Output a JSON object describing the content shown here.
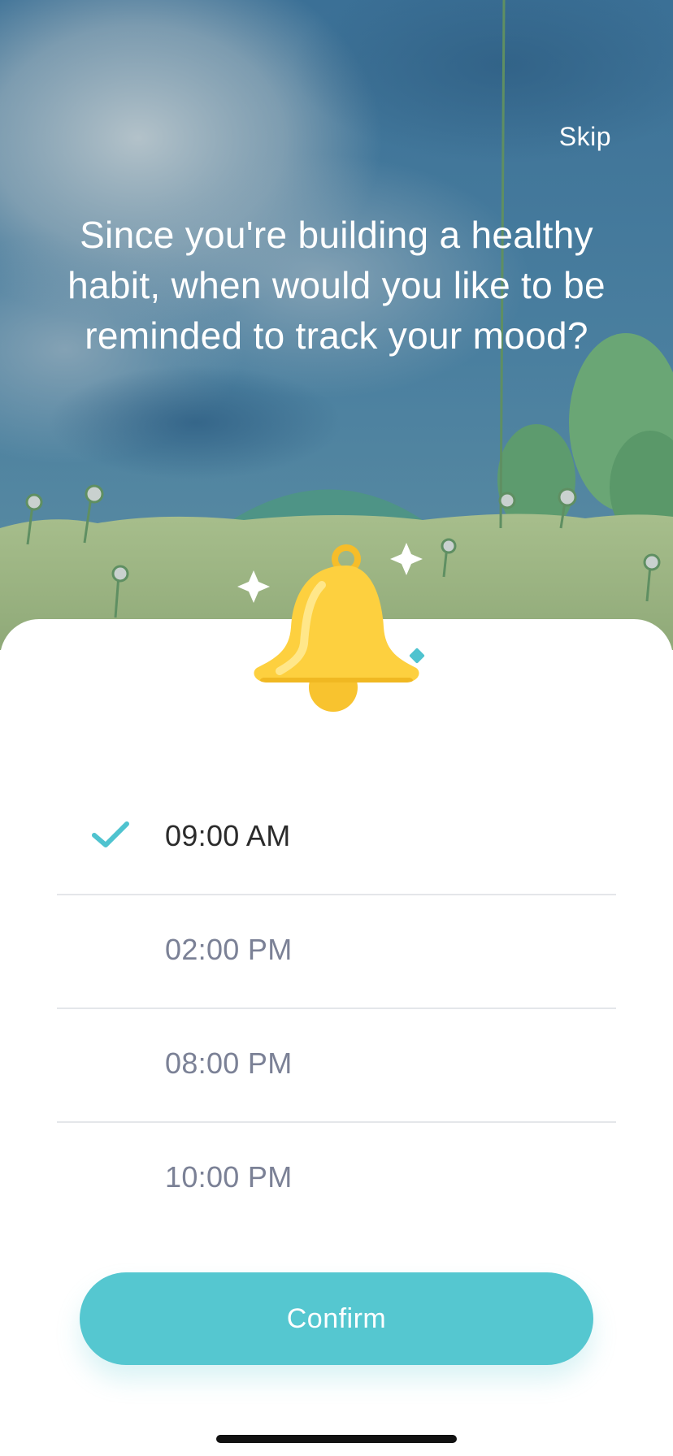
{
  "header": {
    "skip_label": "Skip",
    "question": "Since you're building a healthy habit, when would you like to be reminded to track your mood?"
  },
  "illustration": {
    "scene": "cloudy-sky-meadow-illustration",
    "icon": "bell-icon"
  },
  "reminder_options": [
    {
      "label": "09:00 AM",
      "selected": true
    },
    {
      "label": "02:00 PM",
      "selected": false
    },
    {
      "label": "08:00 PM",
      "selected": false
    },
    {
      "label": "10:00 PM",
      "selected": false
    }
  ],
  "confirm_label": "Confirm",
  "colors": {
    "accent": "#55c7d0",
    "check": "#4fc3cf",
    "selected_text": "#2b2b2b",
    "unselected_text": "#7b8196",
    "bell": "#fdd03f",
    "sky_top": "#3a6f95",
    "grass": "#98b07c"
  }
}
